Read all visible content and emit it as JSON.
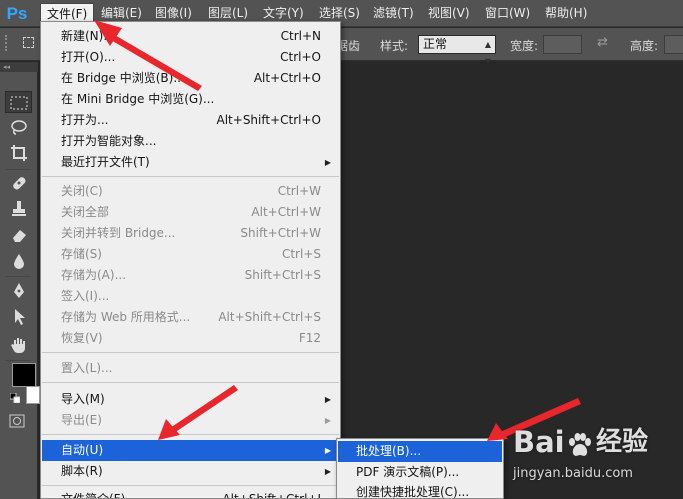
{
  "app": {
    "logo": "Ps"
  },
  "menubar": {
    "items": [
      {
        "label": "文件(F)",
        "active": true
      },
      {
        "label": "编辑(E)"
      },
      {
        "label": "图像(I)"
      },
      {
        "label": "图层(L)"
      },
      {
        "label": "文字(Y)"
      },
      {
        "label": "选择(S)"
      },
      {
        "label": "滤镜(T)"
      },
      {
        "label": "视图(V)"
      },
      {
        "label": "窗口(W)"
      },
      {
        "label": "帮助(H)"
      }
    ]
  },
  "options_bar": {
    "partial_label": "锯齿",
    "style_label": "样式:",
    "style_value": "正常",
    "width_label": "宽度:",
    "height_label": "高度:"
  },
  "file_menu": {
    "items": [
      {
        "label": "新建(N)...",
        "shortcut": "Ctrl+N"
      },
      {
        "label": "打开(O)...",
        "shortcut": "Ctrl+O"
      },
      {
        "label": "在 Bridge 中浏览(B)...",
        "shortcut": "Alt+Ctrl+O"
      },
      {
        "label": "在 Mini Bridge 中浏览(G)...",
        "shortcut": ""
      },
      {
        "label": "打开为...",
        "shortcut": "Alt+Shift+Ctrl+O"
      },
      {
        "label": "打开为智能对象...",
        "shortcut": ""
      },
      {
        "label": "最近打开文件(T)",
        "shortcut": "",
        "submenu": true
      },
      {
        "label": "关闭(C)",
        "shortcut": "Ctrl+W",
        "disabled": true
      },
      {
        "label": "关闭全部",
        "shortcut": "Alt+Ctrl+W",
        "disabled": true
      },
      {
        "label": "关闭并转到 Bridge...",
        "shortcut": "Shift+Ctrl+W",
        "disabled": true
      },
      {
        "label": "存储(S)",
        "shortcut": "Ctrl+S",
        "disabled": true
      },
      {
        "label": "存储为(A)...",
        "shortcut": "Shift+Ctrl+S",
        "disabled": true
      },
      {
        "label": "签入(I)...",
        "shortcut": "",
        "disabled": true
      },
      {
        "label": "存储为 Web 所用格式...",
        "shortcut": "Alt+Shift+Ctrl+S",
        "disabled": true
      },
      {
        "label": "恢复(V)",
        "shortcut": "F12",
        "disabled": true
      },
      {
        "label": "置入(L)...",
        "shortcut": "",
        "disabled": true
      },
      {
        "label": "导入(M)",
        "shortcut": "",
        "submenu": true
      },
      {
        "label": "导出(E)",
        "shortcut": "",
        "submenu": true,
        "disabled": true
      },
      {
        "label": "自动(U)",
        "shortcut": "",
        "submenu": true,
        "highlighted": true
      },
      {
        "label": "脚本(R)",
        "shortcut": "",
        "submenu": true
      },
      {
        "label": "文件简介(F)...",
        "shortcut": "Alt+Shift+Ctrl+I"
      }
    ]
  },
  "automate_submenu": {
    "items": [
      {
        "label": "批处理(B)...",
        "highlighted": true
      },
      {
        "label": "PDF 演示文稿(P)..."
      },
      {
        "label": "创建快捷批处理(C)..."
      }
    ]
  },
  "watermark": {
    "text_left": "Bai",
    "text_right": "经验",
    "url": "jingyan.baidu.com"
  },
  "colors": {
    "accent_highlight": "#1c62d8",
    "annotation_arrow": "#e8262c",
    "ps_blue": "#31a8ff",
    "chrome": "#535353",
    "canvas": "#282828",
    "foreground_swatch": "#000000",
    "background_swatch": "#ffffff"
  },
  "tools": [
    "rectangular-marquee-icon",
    "lasso-icon",
    "crop-icon",
    "spot-healing-brush-icon",
    "clone-stamp-icon",
    "eraser-icon",
    "blur-icon",
    "pen-icon",
    "path-selection-icon",
    "hand-icon"
  ]
}
